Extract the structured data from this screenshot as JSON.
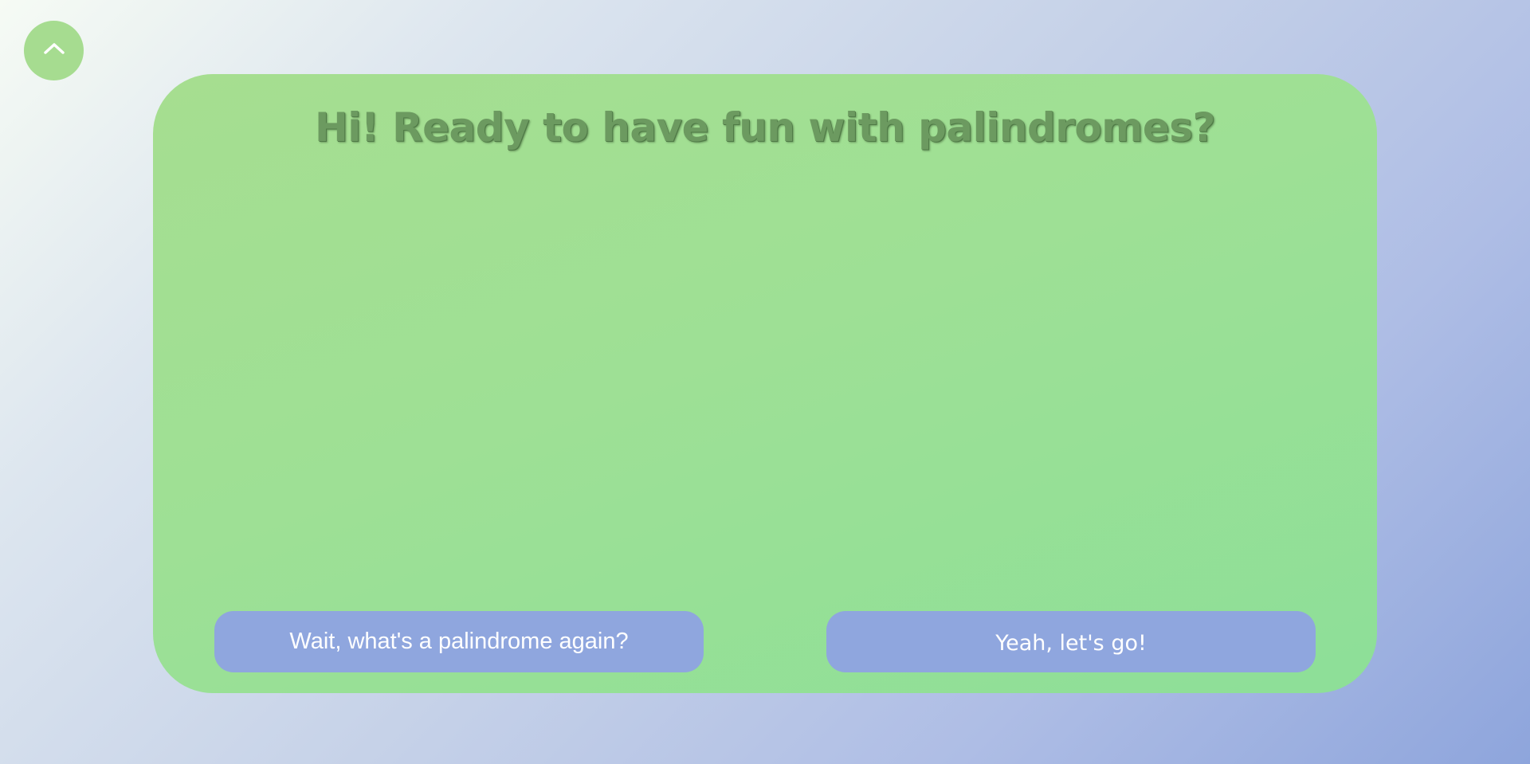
{
  "scroll_top": {
    "icon": "chevron-up-icon"
  },
  "card": {
    "title": "Hi! Ready to have fun with palindromes?"
  },
  "actions": {
    "explain_label": "Wait, what's a palindrome again?",
    "start_label": "Yeah, let's go!"
  },
  "colors": {
    "card_green": "#a6de90",
    "button_blue": "#8fa6de",
    "title_green": "#6c9a60"
  }
}
